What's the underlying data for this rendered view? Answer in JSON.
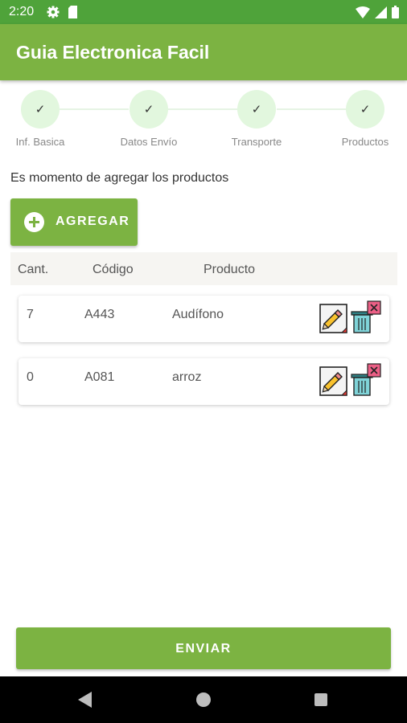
{
  "status_bar": {
    "time": "2:20"
  },
  "app_bar": {
    "title": "Guia Electronica Facil"
  },
  "stepper": {
    "steps": [
      {
        "label": "Inf. Basica",
        "check": "✓"
      },
      {
        "label": "Datos Envío",
        "check": "✓"
      },
      {
        "label": "Transporte",
        "check": "✓"
      },
      {
        "label": "Productos",
        "check": "✓"
      }
    ]
  },
  "main": {
    "instruction": "Es momento de agregar los productos",
    "add_button_label": "AGREGAR"
  },
  "table": {
    "columns": [
      "Cant.",
      "Código",
      "Producto"
    ],
    "rows": [
      {
        "qty": "7",
        "code": "A443",
        "product": "Audífono"
      },
      {
        "qty": "0",
        "code": "A081",
        "product": "arroz"
      }
    ]
  },
  "footer": {
    "send_label": "ENVIAR"
  },
  "colors": {
    "status_bar": "#4fa33a",
    "primary": "#7cb342",
    "step_circle": "#e2f7de",
    "header_bg": "#f6f5f2"
  },
  "icons": [
    "settings-icon",
    "sd-card-icon",
    "wifi-icon",
    "signal-icon",
    "battery-icon",
    "add-circle-icon",
    "edit-pencil-icon",
    "trash-icon",
    "nav-back-icon",
    "nav-home-icon",
    "nav-recent-icon"
  ]
}
